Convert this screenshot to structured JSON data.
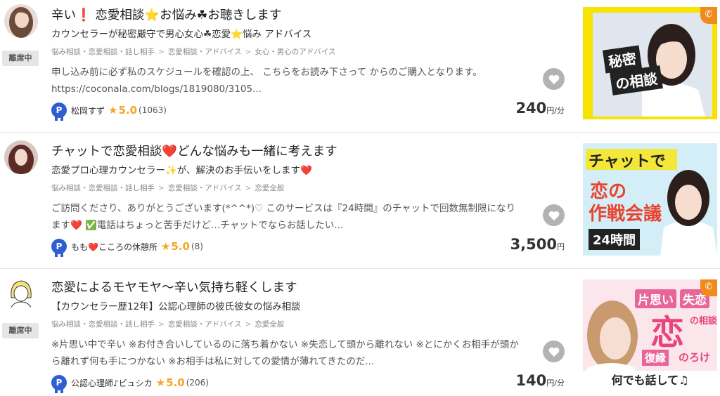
{
  "listings": [
    {
      "title": "辛い❗ 恋愛相談⭐お悩み☘お聴きします",
      "subtitle": "カウンセラーが秘密厳守で男心女心☘恋愛⭐悩み アドバイス",
      "away_label": "離席中",
      "breadcrumbs": [
        "悩み相談・恋愛相談・話し相手",
        "恋愛相談・アドバイス",
        "女心・男心のアドバイス"
      ],
      "description": "申し込み前に必ず私のスケジュールを確認の上、 こちらをお読み下さって からのご購入となります。 https://coconala.com/blogs/1819080/3105...",
      "seller": "松岡すず",
      "rating": "5.0",
      "review_count": "(1063)",
      "price": "240",
      "price_unit": "円/分",
      "thumbnail": {
        "label_1": "秘密",
        "label_2": "の相談",
        "phone_icon": "phone-icon"
      }
    },
    {
      "title": "チャットで恋愛相談❤️どんな悩みも一緒に考えます",
      "subtitle": "恋愛プロ心理カウンセラー✨が、解決のお手伝いをします❤️",
      "away_label": "",
      "breadcrumbs": [
        "悩み相談・恋愛相談・話し相手",
        "恋愛相談・アドバイス",
        "恋愛全般"
      ],
      "description": "ご訪問くださり、ありがとうございます(*^^*)♡ このサービスは『24時間』のチャットで回数無制限になります❤️ ✅電話はちょっと苦手だけど…チャットでならお話したい...",
      "seller": "もも❤️こころの休憩所",
      "rating": "5.0",
      "review_count": "(8)",
      "price": "3,500",
      "price_unit": "円",
      "thumbnail": {
        "label_1": "チャットで",
        "label_2": "恋の",
        "label_3": "作戦会議",
        "label_4": "24時間"
      }
    },
    {
      "title": "恋愛によるモヤモヤ〜辛い気持ち軽くします",
      "subtitle": "【カウンセラー歴12年】公認心理師の彼氏彼女の悩み相談",
      "away_label": "離席中",
      "breadcrumbs": [
        "悩み相談・恋愛相談・話し相手",
        "恋愛相談・アドバイス",
        "恋愛全般"
      ],
      "description": "※片思い中で辛い ※お付き合いしているのに落ち着かない ※失恋して頭から離れない ※とにかくお相手が頭から離れず何も手につかない ※お相手は私に対しての愛情が薄れてきたのだ...",
      "seller": "公認心理師♪ピュシカ",
      "rating": "5.0",
      "review_count": "(206)",
      "price": "140",
      "price_unit": "円/分",
      "thumbnail": {
        "label_1": "片思い",
        "label_2": "失恋",
        "label_3": "恋",
        "label_4": "の相談",
        "label_5": "復縁",
        "label_6": "のろけ",
        "label_7": "何でも話して♫",
        "phone_icon": "phone-icon"
      }
    }
  ],
  "colors": {
    "star": "#f5a623",
    "badge": "#2d5fd0",
    "heart_bg": "#b3b3b3",
    "away_bg": "#e5e5e5"
  }
}
